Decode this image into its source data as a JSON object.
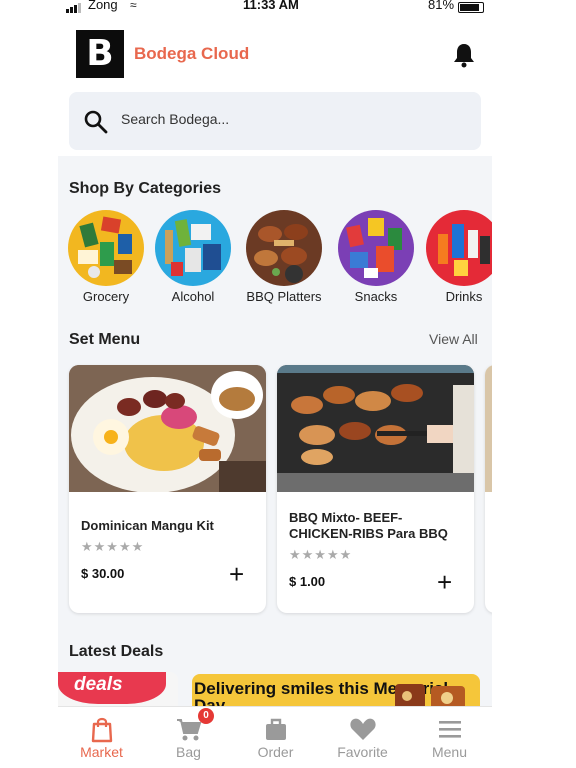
{
  "status_bar": {
    "carrier": "Zong",
    "time": "11:33 AM",
    "battery": "81%"
  },
  "header": {
    "logo_letter": "B",
    "brand": "Bodega Cloud"
  },
  "search": {
    "placeholder": "Search Bodega..."
  },
  "categories": {
    "title": "Shop By Categories",
    "items": [
      {
        "label": "Grocery",
        "color": "#f2b720"
      },
      {
        "label": "Alcohol",
        "color": "#2aa8df"
      },
      {
        "label": "BBQ Platters",
        "color": "#6b3a24"
      },
      {
        "label": "Snacks",
        "color": "#7b3fb5"
      },
      {
        "label": "Drinks",
        "color": "#e42a37"
      }
    ]
  },
  "set_menu": {
    "title": "Set Menu",
    "view_all": "View All",
    "items": [
      {
        "title": "Dominican Mangu Kit",
        "stars": "★★★★★",
        "price": "$ 30.00",
        "add": "+"
      },
      {
        "title": "BBQ Mixto- BEEF-CHICKEN-RIBS Para BBQ",
        "stars": "★★★★★",
        "price": "$ 1.00",
        "add": "+"
      }
    ]
  },
  "latest_deals": {
    "title": "Latest Deals",
    "deal_1_text": "deals",
    "deal_2_text": "Delivering smiles this Memorial Day"
  },
  "tab_bar": {
    "items": [
      {
        "label": "Market",
        "icon": "shopping-bag-icon",
        "active": true
      },
      {
        "label": "Bag",
        "icon": "cart-icon",
        "badge": "0"
      },
      {
        "label": "Order",
        "icon": "briefcase-icon"
      },
      {
        "label": "Favorite",
        "icon": "heart-icon"
      },
      {
        "label": "Menu",
        "icon": "hamburger-menu-icon"
      }
    ]
  },
  "colors": {
    "accent": "#e8684e",
    "background": "#f3f5f8",
    "badge": "#e53935"
  }
}
